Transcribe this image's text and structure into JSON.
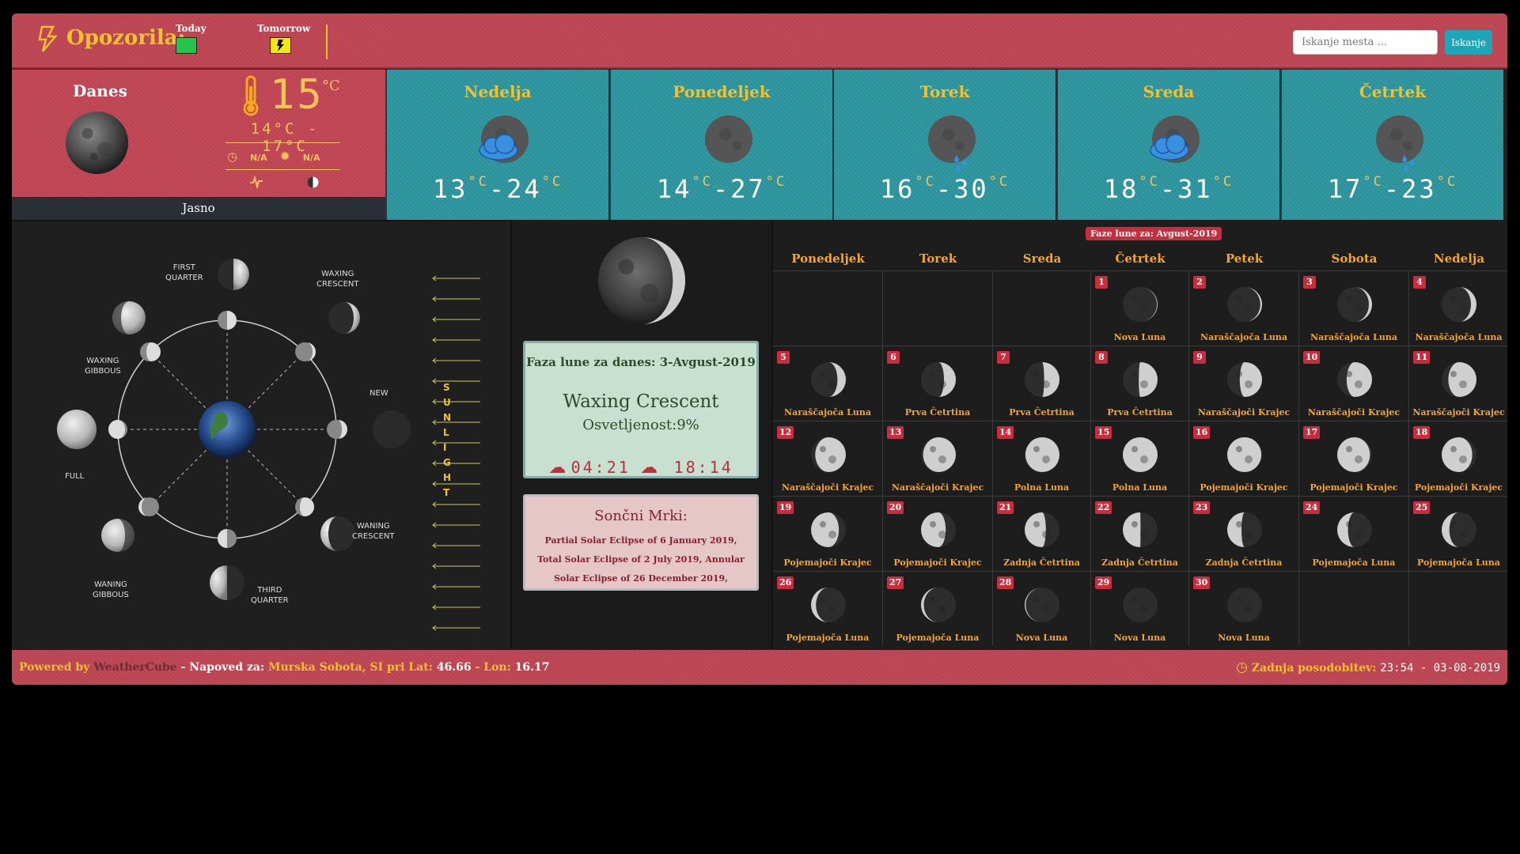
{
  "alerts": {
    "title": "Opozorila:",
    "today_label": "Today",
    "tomorrow_label": "Tomorrow",
    "today_color": "#27c34a",
    "tomorrow_color": "#f5e615"
  },
  "search": {
    "placeholder": "Iskanje mesta ...",
    "button": "Iskanje"
  },
  "today": {
    "name": "Danes",
    "temp": "15",
    "unit": "°C",
    "range": "14°C - 17°C",
    "sunrise": "N/A",
    "sunset": "N/A",
    "condition": "Jasno"
  },
  "forecast": [
    {
      "day": "Nedelja",
      "low": "13",
      "high": "24",
      "icon": "cloud-moon-icon"
    },
    {
      "day": "Ponedeljek",
      "low": "14",
      "high": "27",
      "icon": "moon-icon"
    },
    {
      "day": "Torek",
      "low": "16",
      "high": "30",
      "icon": "rain-moon-icon"
    },
    {
      "day": "Sreda",
      "low": "18",
      "high": "31",
      "icon": "cloud-moon-icon"
    },
    {
      "day": "Četrtek",
      "low": "17",
      "high": "23",
      "icon": "rain-moon-icon"
    }
  ],
  "diagram": {
    "labels": {
      "first_quarter": "FIRST\nQUARTER",
      "waxing_crescent": "WAXING\nCRESCENT",
      "waxing_gibbous": "WAXING\nGIBBOUS",
      "new": "NEW",
      "full": "FULL",
      "waning_crescent": "WANING\nCRESCENT",
      "waning_gibbous": "WANING\nGIBBOUS",
      "third_quarter": "THIRD\nQUARTER"
    },
    "sunlight": [
      "S",
      "U",
      "N",
      "L",
      "I",
      "G",
      "H",
      "T"
    ]
  },
  "moon_today": {
    "heading": "Faza lune za danes: 3-Avgust-2019",
    "phase": "Waxing Crescent",
    "illumination": "Osvetljenost:9%",
    "rise": "04:21",
    "set": "18:14"
  },
  "eclipse": {
    "heading": "Sončni Mrki:",
    "text": "Partial Solar Eclipse of 6 January 2019, Total Solar Eclipse of 2 July 2019, Annular Solar Eclipse of 26 December 2019,"
  },
  "calendar": {
    "badge": "Faze lune za: Avgust-2019",
    "weekdays": [
      "Ponedeljek",
      "Torek",
      "Sreda",
      "Četrtek",
      "Petek",
      "Sobota",
      "Nedelja"
    ],
    "days": [
      {
        "d": "1",
        "label": "Nova Luna",
        "lit": 0.02
      },
      {
        "d": "2",
        "label": "Naraščajoča Luna",
        "lit": 0.05
      },
      {
        "d": "3",
        "label": "Naraščajoča Luna",
        "lit": 0.09
      },
      {
        "d": "4",
        "label": "Naraščajoča Luna",
        "lit": 0.16
      },
      {
        "d": "5",
        "label": "Naraščajoča Luna",
        "lit": 0.24
      },
      {
        "d": "6",
        "label": "Prva Četrtina",
        "lit": 0.34
      },
      {
        "d": "7",
        "label": "Prva Četrtina",
        "lit": 0.44
      },
      {
        "d": "8",
        "label": "Prva Četrtina",
        "lit": 0.54
      },
      {
        "d": "9",
        "label": "Naraščajoči Krajec",
        "lit": 0.64
      },
      {
        "d": "10",
        "label": "Naraščajoči Krajec",
        "lit": 0.73
      },
      {
        "d": "11",
        "label": "Naraščajoči Krajec",
        "lit": 0.81
      },
      {
        "d": "12",
        "label": "Naraščajoči Krajec",
        "lit": 0.88
      },
      {
        "d": "13",
        "label": "Naraščajoči Krajec",
        "lit": 0.94
      },
      {
        "d": "14",
        "label": "Polna Luna",
        "lit": 0.98
      },
      {
        "d": "15",
        "label": "Polna Luna",
        "lit": 1.0
      },
      {
        "d": "16",
        "label": "Pojemajoči Krajec",
        "lit": 0.98
      },
      {
        "d": "17",
        "label": "Pojemajoči Krajec",
        "lit": 0.94
      },
      {
        "d": "18",
        "label": "Pojemajoči Krajec",
        "lit": 0.88
      },
      {
        "d": "19",
        "label": "Pojemajoči Krajec",
        "lit": 0.8
      },
      {
        "d": "20",
        "label": "Pojemajoči Krajec",
        "lit": 0.71
      },
      {
        "d": "21",
        "label": "Zadnja Četrtina",
        "lit": 0.61
      },
      {
        "d": "22",
        "label": "Zadnja Četrtina",
        "lit": 0.51
      },
      {
        "d": "23",
        "label": "Zadnja Četrtina",
        "lit": 0.41
      },
      {
        "d": "24",
        "label": "Pojemajoča Luna",
        "lit": 0.31
      },
      {
        "d": "25",
        "label": "Pojemajoča Luna",
        "lit": 0.22
      },
      {
        "d": "26",
        "label": "Pojemajoča Luna",
        "lit": 0.14
      },
      {
        "d": "27",
        "label": "Pojemajoča Luna",
        "lit": 0.08
      },
      {
        "d": "28",
        "label": "Nova Luna",
        "lit": 0.03
      },
      {
        "d": "29",
        "label": "Nova Luna",
        "lit": 0.01
      },
      {
        "d": "30",
        "label": "Nova Luna",
        "lit": 0.0
      }
    ]
  },
  "footer": {
    "powered": "Powered by",
    "brand": "WeatherCube",
    "forecast_for": "- Napoved za:",
    "place": "Murska Sobota, SI pri",
    "lat_label": "Lat:",
    "lat": "46.66",
    "lon_label": "- Lon:",
    "lon": "16.17",
    "updated_label": "Zadnja posodobitev:",
    "updated": "23:54 - 03-08-2019"
  }
}
